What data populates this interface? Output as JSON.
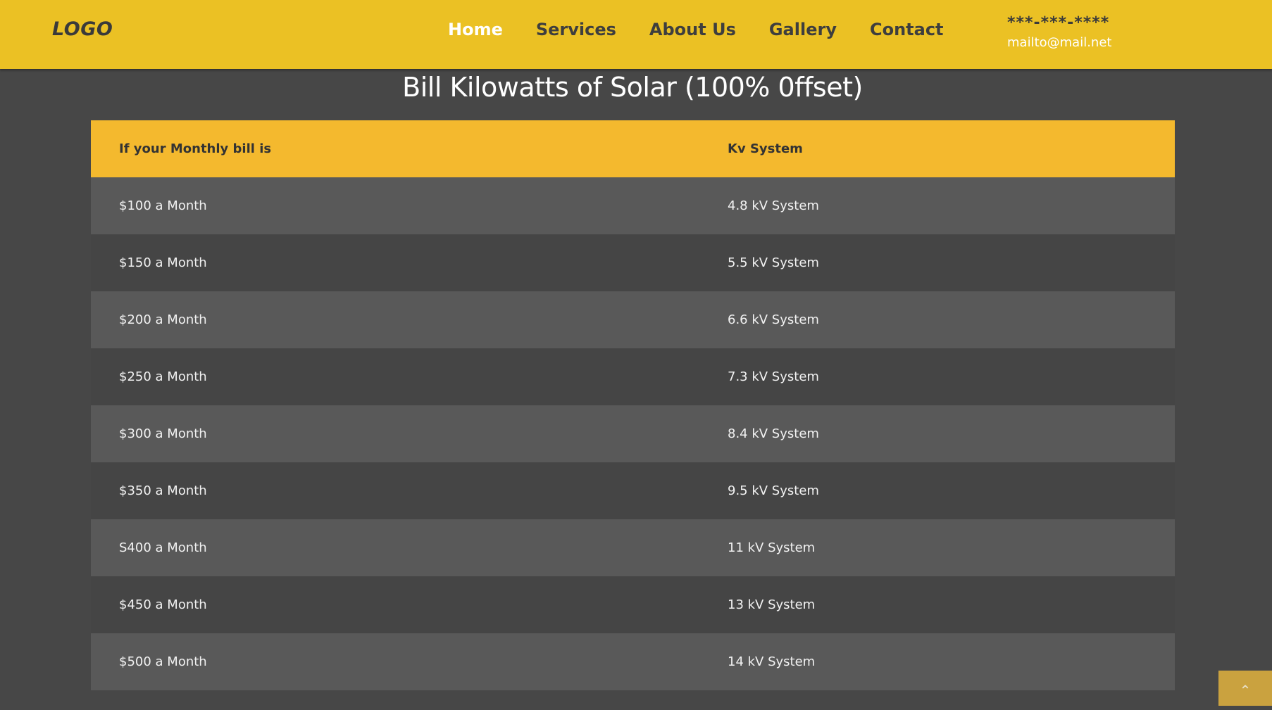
{
  "header": {
    "logo": "LOGO",
    "nav": [
      {
        "label": "Home",
        "active": true
      },
      {
        "label": "Services",
        "active": false
      },
      {
        "label": "About Us",
        "active": false
      },
      {
        "label": "Gallery",
        "active": false
      },
      {
        "label": "Contact",
        "active": false
      }
    ],
    "phone": "***-***-****",
    "email": "mailto@mail.net"
  },
  "main": {
    "title": "Bill Kilowatts of Solar (100% 0ffset)",
    "table": {
      "columns": [
        "If your Monthly bill is",
        "Kv System"
      ],
      "rows": [
        [
          "$100 a Month",
          "4.8 kV System"
        ],
        [
          "$150 a Month",
          "5.5 kV System"
        ],
        [
          "$200 a Month",
          "6.6 kV System"
        ],
        [
          "$250 a Month",
          "7.3 kV System"
        ],
        [
          "$300 a Month",
          "8.4 kV System"
        ],
        [
          "$350 a Month",
          "9.5 kV System"
        ],
        [
          "S400 a Month",
          "11 kV System"
        ],
        [
          "$450 a Month",
          "13 kV System"
        ],
        [
          "$500 a Month",
          "14 kV System"
        ]
      ]
    }
  },
  "scroll_top": {
    "icon": "chevron-up-icon",
    "glyph": "⌃"
  },
  "colors": {
    "header_bg": "#ebc124",
    "table_head_bg": "#f4b92e",
    "page_bg": "#474747",
    "row_light": "#595959",
    "row_dark": "#454545"
  }
}
